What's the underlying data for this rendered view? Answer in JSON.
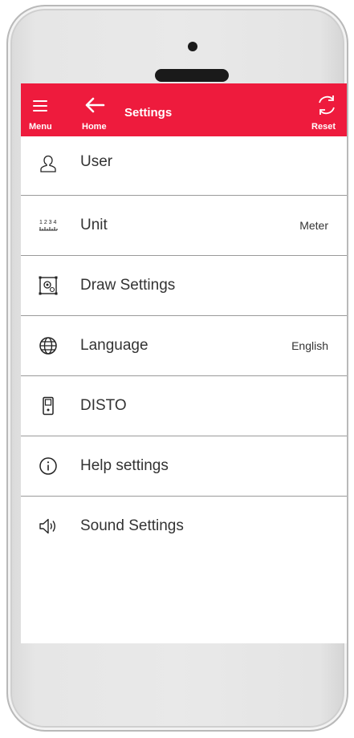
{
  "appbar": {
    "menu_label": "Menu",
    "home_label": "Home",
    "title": "Settings",
    "reset_label": "Reset",
    "color": "#ee1b3d"
  },
  "settings": {
    "items": [
      {
        "icon": "user-icon",
        "label": "User",
        "value": ""
      },
      {
        "icon": "ruler-icon",
        "label": "Unit",
        "value": "Meter"
      },
      {
        "icon": "draw-settings-icon",
        "label": "Draw Settings",
        "value": ""
      },
      {
        "icon": "globe-icon",
        "label": "Language",
        "value": "English"
      },
      {
        "icon": "device-icon",
        "label": "DISTO",
        "value": ""
      },
      {
        "icon": "info-icon",
        "label": "Help settings",
        "value": ""
      },
      {
        "icon": "speaker-icon",
        "label": "Sound Settings",
        "value": ""
      }
    ]
  }
}
